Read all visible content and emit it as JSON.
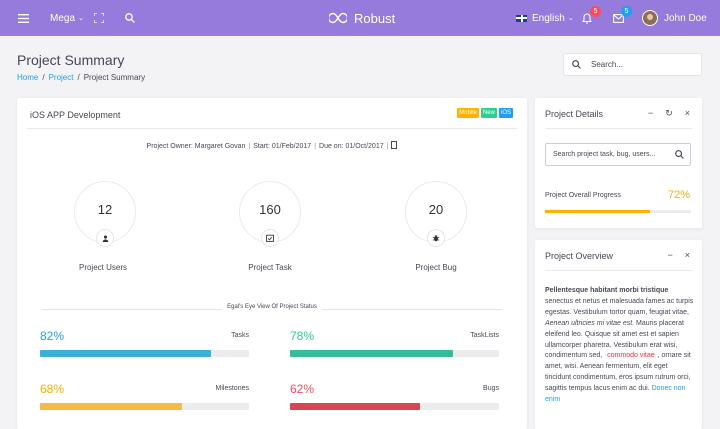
{
  "navbar": {
    "menu_icon": "hamburger-icon",
    "mega_label": "Mega",
    "brand": "Robust",
    "language": "English",
    "notifications_count": "5",
    "messages_count": "5",
    "user_name": "John Doe",
    "bg_color": "#967adc"
  },
  "header": {
    "title": "Project Summary",
    "breadcrumb": [
      "Home",
      "Project",
      "Project Summary"
    ],
    "search_placeholder": "Search..."
  },
  "main_card": {
    "title": "iOS APP Development",
    "tags": [
      {
        "label": "Mobile",
        "color": "#ffb000"
      },
      {
        "label": "New",
        "color": "#28d094"
      },
      {
        "label": "iOS",
        "color": "#1e9ff2"
      }
    ],
    "owner": "Project Owner: Margaret Govan",
    "start": "Start: 01/Feb/2017",
    "due": "Due on: 01/Oct/2017",
    "stats": [
      {
        "value": "12",
        "label": "Project Users",
        "icon": "user-icon"
      },
      {
        "value": "160",
        "label": "Project Task",
        "icon": "calendar-check-icon"
      },
      {
        "value": "20",
        "label": "Project Bug",
        "icon": "bug-icon"
      }
    ],
    "status_heading": "Egal's Eye View Of Project Status",
    "metrics": [
      {
        "pct": "82%",
        "name": "Tasks",
        "value": 82,
        "color": "#3bafda"
      },
      {
        "pct": "78%",
        "name": "TaskLists",
        "value": 78,
        "color": "#37bc9b"
      },
      {
        "pct": "68%",
        "name": "Milestones",
        "value": 68,
        "color": "#f6bb42"
      },
      {
        "pct": "62%",
        "name": "Bugs",
        "value": 62,
        "color": "#da4453"
      }
    ]
  },
  "details_card": {
    "title": "Project Details",
    "search_placeholder": "Search project task, bug, users...",
    "progress_label": "Project Overall Progress",
    "progress_pct": "72%",
    "progress_value": 72
  },
  "overview_card": {
    "title": "Project Overview",
    "bold_text": "Pellentesque habitant morbi tristique",
    "text1": " senectus et netus et malesuada fames ac turpis egestas. Vestibulum tortor quam, feugiat vitae, ",
    "italic_text": "Aenean ultricies mi vitae est.",
    "text2": " Mauris placerat eleifend leo. Quisque sit amet est et sapien ullamcorper pharetra. Vestibulum erat wisi, condimentum sed, ",
    "code_text": "commodo vitae",
    "text3": ", ornare sit amet, wisi. Aenean fermentum, elit eget tincidunt condimentum, eros ipsum rutrum orci, sagittis tempus lacus enim ac dui. ",
    "link_text": "Donec non enim"
  }
}
